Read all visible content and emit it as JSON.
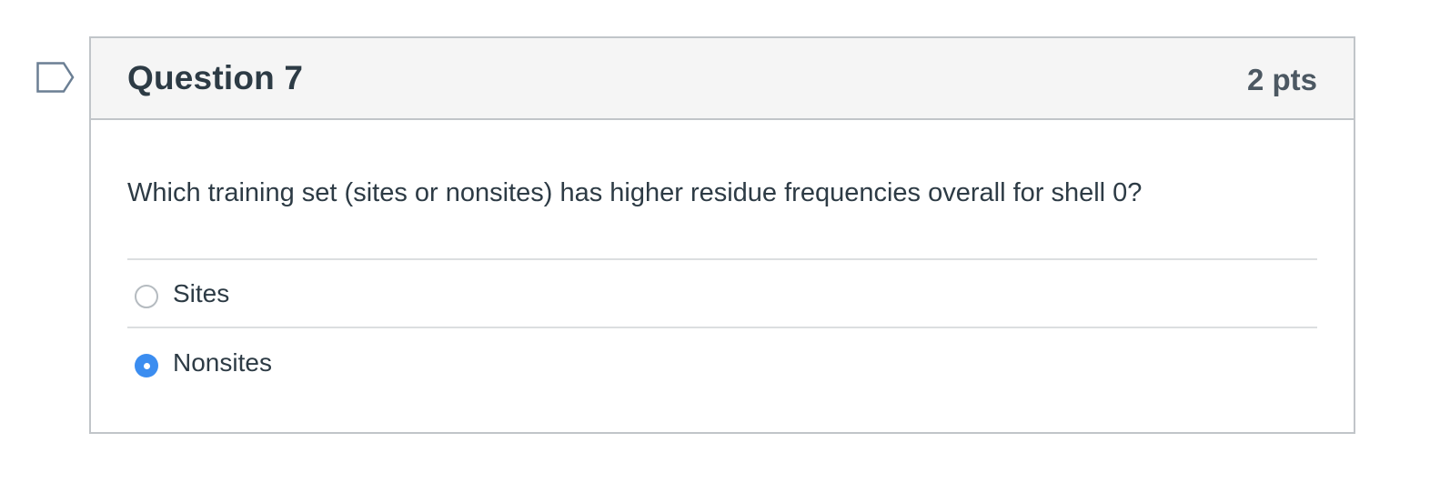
{
  "question": {
    "title": "Question 7",
    "points": "2 pts",
    "text": "Which training set (sites or nonsites) has higher residue frequencies overall for shell 0?",
    "flagged": false
  },
  "answers": [
    {
      "label": "Sites",
      "selected": false
    },
    {
      "label": "Nonsites",
      "selected": true
    }
  ],
  "colors": {
    "accent": "#3b8df0",
    "text": "#2d3b45",
    "header_bg": "#f5f5f5",
    "border": "#c1c5c9"
  }
}
